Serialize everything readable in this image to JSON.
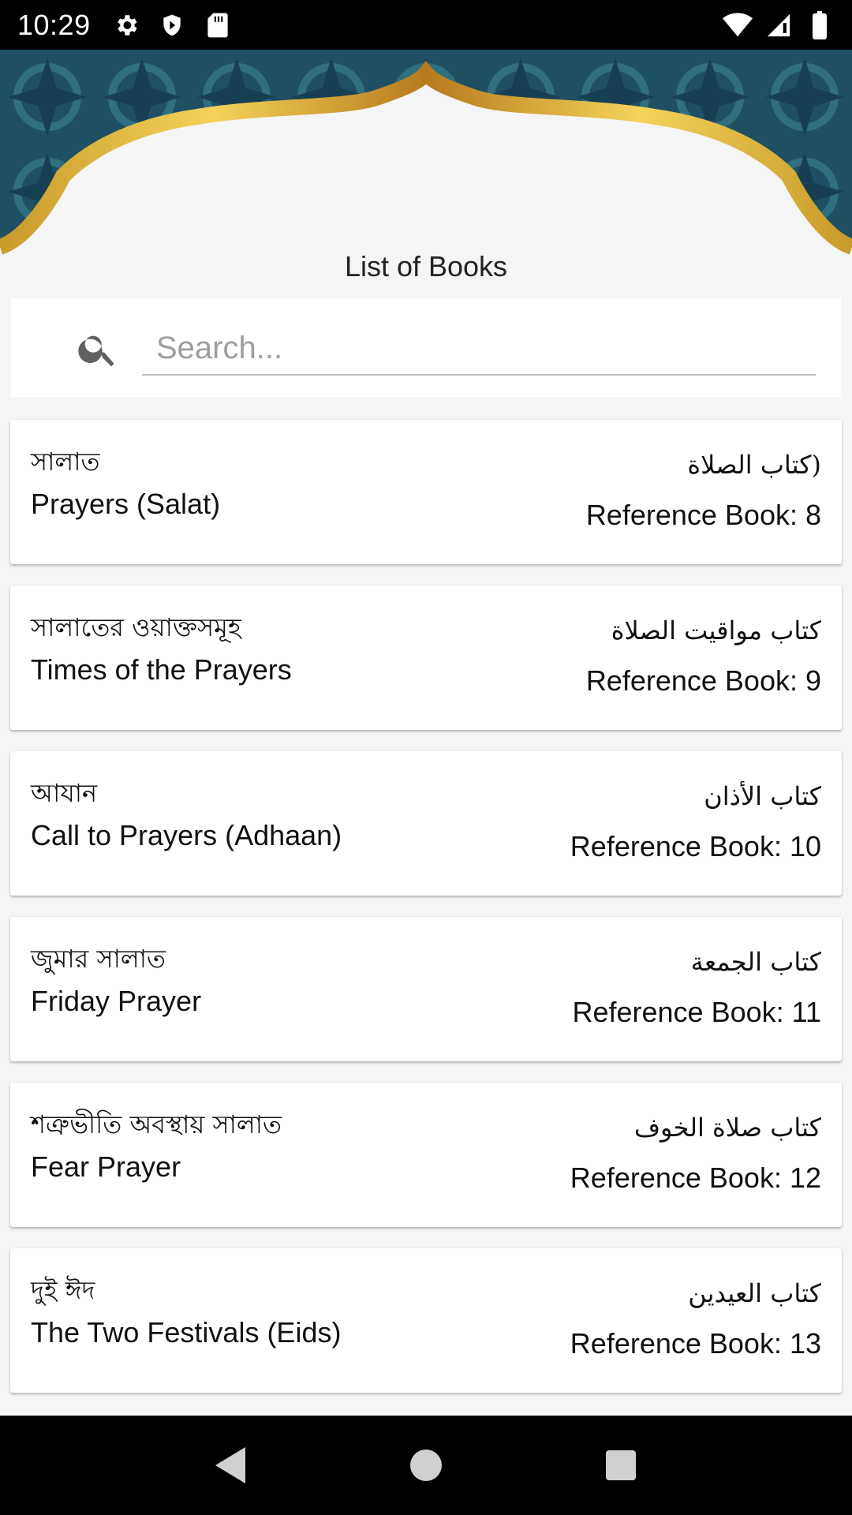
{
  "status_bar": {
    "time": "10:29",
    "left_icons": [
      "gear-icon",
      "shield-icon",
      "sd-card-icon"
    ],
    "right_icons": [
      "wifi-icon",
      "signal-icon",
      "battery-icon"
    ]
  },
  "header": {
    "title": "List of Books"
  },
  "search": {
    "placeholder": "Search..."
  },
  "books": [
    {
      "bn": "সালাত",
      "en": "Prayers (Salat)",
      "ar": "(كتاب الصلاة",
      "ref": "Reference Book: 8"
    },
    {
      "bn": "সালাতের ওয়াক্তসমূহ",
      "en": "Times of the Prayers",
      "ar": "كتاب مواقيت الصلاة",
      "ref": "Reference Book: 9"
    },
    {
      "bn": "আযান",
      "en": "Call to Prayers (Adhaan)",
      "ar": "كتاب الأذان",
      "ref": "Reference Book: 10"
    },
    {
      "bn": "জুমার সালাত",
      "en": "Friday Prayer",
      "ar": "كتاب الجمعة",
      "ref": "Reference Book: 11"
    },
    {
      "bn": "শত্রুভীতি অবস্থায় সালাত",
      "en": "Fear Prayer",
      "ar": "كتاب صلاة الخوف",
      "ref": "Reference Book: 12"
    },
    {
      "bn": "দুই ঈদ",
      "en": "The Two Festivals (Eids)",
      "ar": "كتاب العيدين",
      "ref": "Reference Book: 13"
    }
  ],
  "nav_bar": {
    "buttons": [
      "back-icon",
      "home-icon",
      "recents-icon"
    ]
  },
  "colors": {
    "banner_teal": "#1f4f63",
    "banner_gold": "#e0b83a",
    "background": "#f5f5f5"
  }
}
